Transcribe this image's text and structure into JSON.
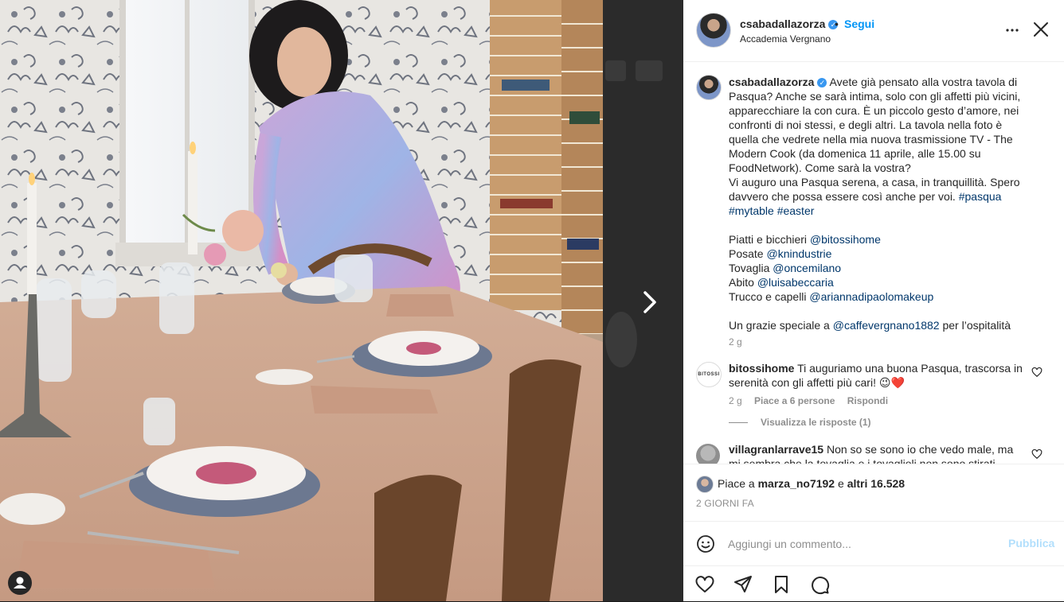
{
  "post": {
    "username": "csabadallazorza",
    "follow_label": "Segui",
    "dot": "•",
    "location": "Accademia Vergnano",
    "verified_mark": "✓"
  },
  "caption": {
    "username": "csabadallazorza",
    "lines": [
      "Avete già pensato alla vostra tavola di",
      "Pasqua? Anche se sarà intima, solo con gli affetti più vicini,",
      "apparecchiare la con cura. È un piccolo gesto d’amore, nei",
      "confronti di noi stessi, e degli altri. La tavola nella foto è",
      "quella che vedrete nella mia nuova trasmissione TV - The",
      "Modern Cook (da domenica 11 aprile, alle 15.00 su",
      "FoodNetwork). Come sarà la vostra?",
      "Vi auguro una Pasqua serena, a casa, in tranquillità. Spero",
      "davvero che possa essere così anche per voi."
    ],
    "hashtag_1": "#pasqua",
    "hashtag_2": "#mytable",
    "hashtag_3": "#easter",
    "credits": [
      {
        "label": "Piatti e bicchieri",
        "handle": "@bitossihome"
      },
      {
        "label": "Posate",
        "handle": "@knindustrie"
      },
      {
        "label": "Tovaglia",
        "handle": "@oncemilano"
      },
      {
        "label": "Abito",
        "handle": "@luisabeccaria"
      },
      {
        "label": "Trucco e capelli",
        "handle": "@ariannadipaolomakeup"
      }
    ],
    "thanks_prefix": "Un grazie speciale a",
    "thanks_handle": "@caffevergnano1882",
    "thanks_suffix": "per l’ospitalità",
    "time": "2 g"
  },
  "comments": [
    {
      "username": "bitossihome",
      "avatar_text": "BITOSSI",
      "text": "Ti auguriamo una buona Pasqua, trascorsa in serenità con gli affetti più cari! 😉❤️",
      "time": "2 g",
      "likes": "Piace a 6 persone",
      "reply": "Rispondi",
      "view_replies": "Visualizza le risposte (1)"
    },
    {
      "username": "villagranlarrave15",
      "text": "Non so se sono io che vedo male, ma mi sembra che la tovaglia e i tovaglioli non sono stirati bene?"
    }
  ],
  "likes": {
    "prefix": "Piace a",
    "user": "marza_no7192",
    "middle": "e",
    "others": "altri 16.528"
  },
  "post_age": "2 GIORNI FA",
  "comment_box": {
    "emoji_icon": "smiley-icon",
    "placeholder": "Aggiungi un commento...",
    "publish": "Pubblica"
  },
  "actions": [
    "heart-icon",
    "paper-plane-icon",
    "bookmark-icon",
    "speech-bubble-icon"
  ],
  "colors": {
    "link": "#00376b",
    "follow": "#0095f6",
    "verified": "#3897f0",
    "publish_disabled": "#b2dffc",
    "secondary_text": "#8e8e8e"
  }
}
